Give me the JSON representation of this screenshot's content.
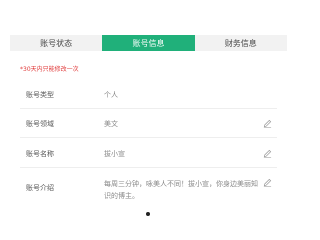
{
  "tabs": [
    {
      "label": "账号状态",
      "active": false
    },
    {
      "label": "账号信息",
      "active": true
    },
    {
      "label": "财务信息",
      "active": false
    }
  ],
  "notice": "*30天内只能修改一次",
  "fields": [
    {
      "label": "账号类型",
      "value": "个人",
      "editable": false
    },
    {
      "label": "账号领域",
      "value": "美文",
      "editable": true
    },
    {
      "label": "账号名称",
      "value": "拔小宣",
      "editable": true
    },
    {
      "label": "账号介绍",
      "value": "每周三分钟，咏美人不同！拔小宣，你身边美丽知识的博主。",
      "editable": true
    }
  ],
  "colors": {
    "accent": "#20b07a",
    "notice": "#e03a3a"
  },
  "icons": {
    "edit": "pencil-icon"
  }
}
